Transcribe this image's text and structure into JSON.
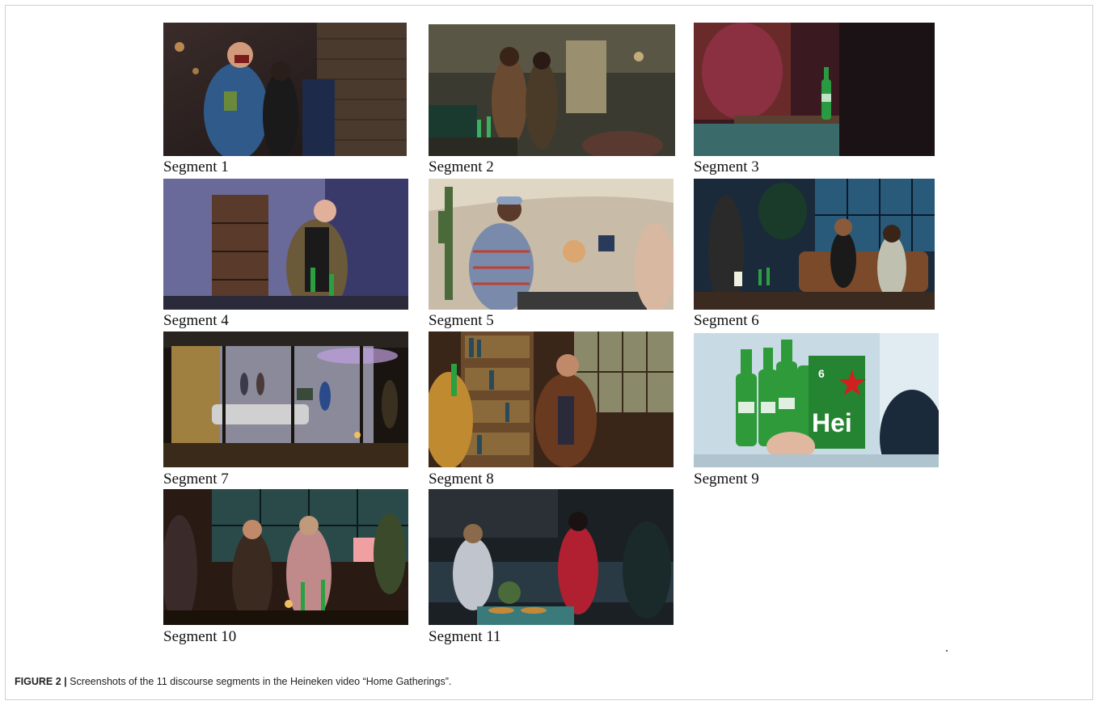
{
  "figure": {
    "caption_lead": "FIGURE 2 |",
    "caption_text": "Screenshots of the 11 discourse segments in the Heineken video “Home Gatherings”."
  },
  "segments": [
    {
      "label": "Segment 1"
    },
    {
      "label": "Segment 2"
    },
    {
      "label": "Segment 3"
    },
    {
      "label": "Segment 4"
    },
    {
      "label": "Segment 5"
    },
    {
      "label": "Segment 6"
    },
    {
      "label": "Segment 7"
    },
    {
      "label": "Segment 8"
    },
    {
      "label": "Segment 9",
      "packaging_text": "Hei",
      "pack_count": "6"
    },
    {
      "label": "Segment 10"
    },
    {
      "label": "Segment 11"
    }
  ]
}
